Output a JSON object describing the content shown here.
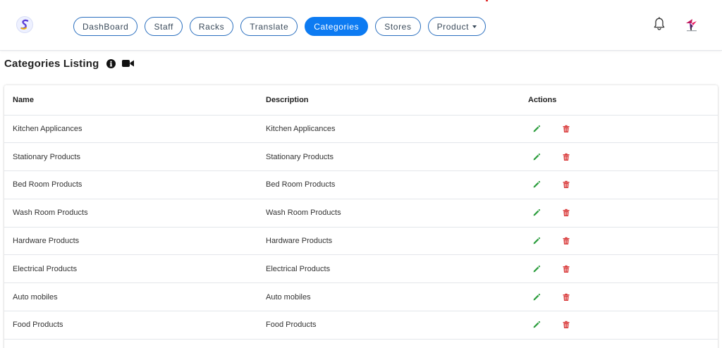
{
  "nav": {
    "items": [
      {
        "label": "DashBoard",
        "active": false
      },
      {
        "label": "Staff",
        "active": false
      },
      {
        "label": "Racks",
        "active": false
      },
      {
        "label": "Translate",
        "active": false
      },
      {
        "label": "Categories",
        "active": true
      },
      {
        "label": "Stores",
        "active": false
      },
      {
        "label": "Product",
        "active": false,
        "dropdown": true
      }
    ]
  },
  "header_icons": [
    "bell-icon",
    "avatar"
  ],
  "page": {
    "title": "Categories Listing",
    "title_icons": [
      "info-icon",
      "video-camera-icon"
    ]
  },
  "table": {
    "columns": [
      "Name",
      "Description",
      "Actions"
    ],
    "rows": [
      {
        "name": "Kitchen Applicances",
        "description": "Kitchen Applicances"
      },
      {
        "name": "Stationary Products",
        "description": "Stationary Products"
      },
      {
        "name": "Bed Room Products",
        "description": "Bed Room Products"
      },
      {
        "name": "Wash Room Products",
        "description": "Wash Room Products"
      },
      {
        "name": "Hardware Products",
        "description": "Hardware Products"
      },
      {
        "name": "Electrical Products",
        "description": "Electrical Products"
      },
      {
        "name": "Auto mobiles",
        "description": "Auto mobiles"
      },
      {
        "name": "Food Products",
        "description": "Food Products"
      }
    ],
    "row_actions": [
      "edit-icon",
      "delete-icon"
    ]
  },
  "colors": {
    "accent": "#0d7bf2",
    "pill_border": "#2a6fbf",
    "edit": "#2e9e3f",
    "delete": "#d93b3b"
  }
}
